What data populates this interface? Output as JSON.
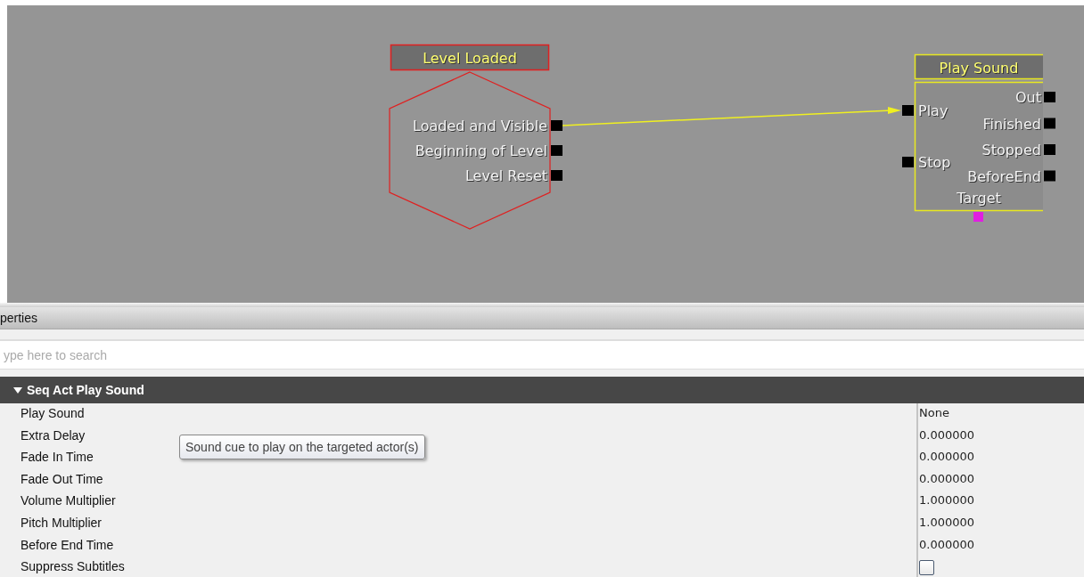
{
  "graph": {
    "event_node": {
      "title": "Level Loaded",
      "outputs": [
        {
          "label": "Loaded and Visible"
        },
        {
          "label": "Beginning of Level"
        },
        {
          "label": "Level Reset"
        }
      ]
    },
    "action_node": {
      "title": "Play Sound",
      "inputs": [
        {
          "label": "Play"
        },
        {
          "label": "Stop"
        }
      ],
      "outputs": [
        "Out",
        "Finished",
        "Stopped",
        "BeforeEnd"
      ],
      "variables": [
        "Target"
      ]
    }
  },
  "properties": {
    "title": "perties",
    "search": {
      "placeholder": "ype here to search"
    },
    "category": {
      "title": "Seq Act Play Sound",
      "expanded": true
    },
    "rows": [
      {
        "label": "Play Sound",
        "kind": "text",
        "value": "None"
      },
      {
        "label": "Extra Delay",
        "kind": "text",
        "value": "0.000000"
      },
      {
        "label": "Fade In Time",
        "kind": "text",
        "value": "0.000000"
      },
      {
        "label": "Fade Out Time",
        "kind": "text",
        "value": "0.000000"
      },
      {
        "label": "Volume Multiplier",
        "kind": "text",
        "value": "1.000000"
      },
      {
        "label": "Pitch Multiplier",
        "kind": "text",
        "value": "1.000000"
      },
      {
        "label": "Before End Time",
        "kind": "text",
        "value": "0.000000"
      },
      {
        "label": "Suppress Subtitles",
        "kind": "checkbox",
        "checked": false
      }
    ],
    "tooltip": "Sound cue to play on the targeted actor(s)"
  }
}
